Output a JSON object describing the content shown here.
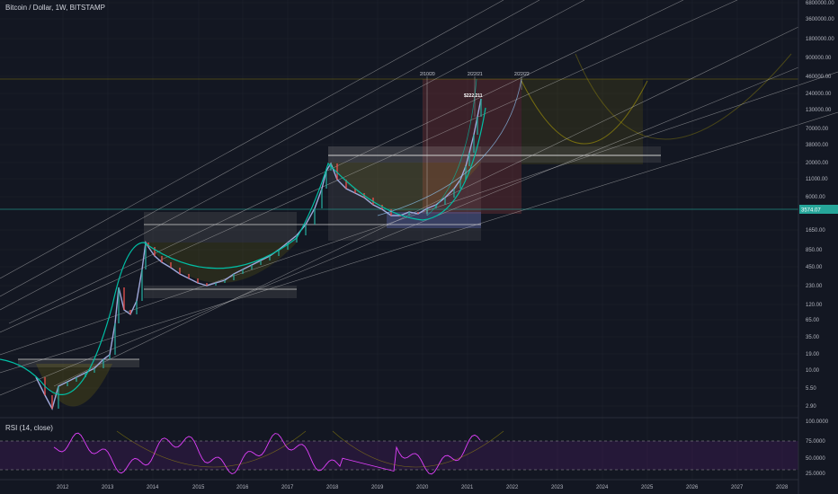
{
  "header": {
    "title": "Bitcoin / Dollar, 1W, BITSTAMP"
  },
  "rsi": {
    "label": "RSI (14, close)"
  },
  "price_scale": [
    "6800000.00",
    "3600000.00",
    "1800000.00",
    "900000.00",
    "460000.00",
    "240000.00",
    "130000.00",
    "70000.00",
    "38000.00",
    "20000.00",
    "11000.00",
    "6000.00",
    "1650.00",
    "850.00",
    "450.00",
    "230.00",
    "120.00",
    "65.00",
    "35.00",
    "19.00",
    "10.00",
    "5.50",
    "2.90"
  ],
  "last_price": {
    "value": "3574.07",
    "color": "#26a69a"
  },
  "rsi_scale": [
    "100.0000",
    "75.0000",
    "50.0000",
    "25.0000"
  ],
  "time_axis": [
    "2012",
    "2013",
    "2014",
    "2015",
    "2016",
    "2017",
    "2018",
    "2019",
    "2020",
    "2021",
    "2022",
    "2023",
    "2024",
    "2025",
    "2026",
    "2027",
    "2028"
  ],
  "date_labels": [
    "2/10/20",
    "2/22/21",
    "2/22/22"
  ],
  "target_label": "$222,211",
  "colors": {
    "bg": "#131722",
    "grid": "#1e222d",
    "up": "#26a69a",
    "down": "#ef5350",
    "curve": "#00bfa5",
    "rsi": "#e040fb",
    "trend": "#c8c8c8"
  }
}
